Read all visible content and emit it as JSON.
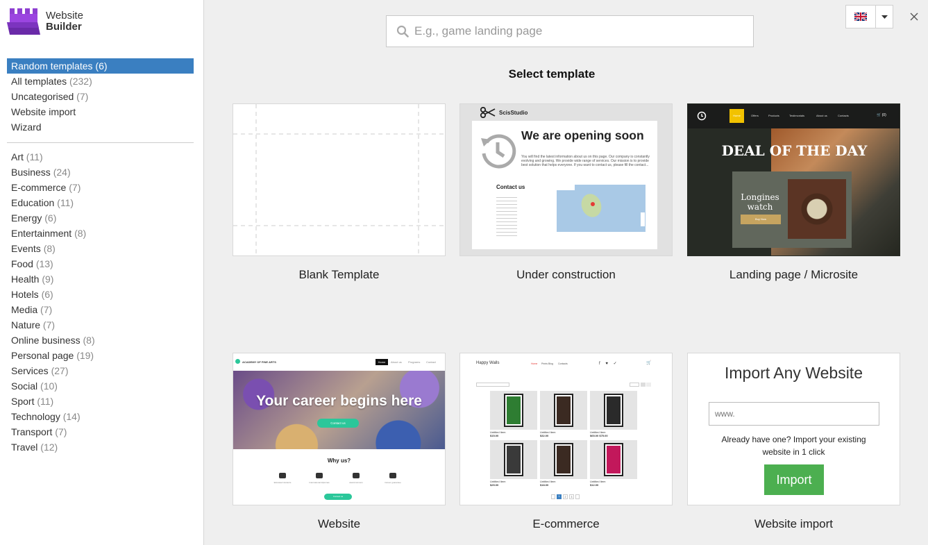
{
  "brand": {
    "line1": "Website",
    "line2": "Builder"
  },
  "nav_primary": [
    {
      "name": "Random templates",
      "count": "(6)",
      "active": true
    },
    {
      "name": "All templates",
      "count": "(232)"
    },
    {
      "name": "Uncategorised",
      "count": "(7)"
    },
    {
      "name": "Website import",
      "count": ""
    },
    {
      "name": "Wizard",
      "count": ""
    }
  ],
  "nav_categories": [
    {
      "name": "Art",
      "count": "(11)"
    },
    {
      "name": "Business",
      "count": "(24)"
    },
    {
      "name": "E-commerce",
      "count": "(7)"
    },
    {
      "name": "Education",
      "count": "(11)"
    },
    {
      "name": "Energy",
      "count": "(6)"
    },
    {
      "name": "Entertainment",
      "count": "(8)"
    },
    {
      "name": "Events",
      "count": "(8)"
    },
    {
      "name": "Food",
      "count": "(13)"
    },
    {
      "name": "Health",
      "count": "(9)"
    },
    {
      "name": "Hotels",
      "count": "(6)"
    },
    {
      "name": "Media",
      "count": "(7)"
    },
    {
      "name": "Nature",
      "count": "(7)"
    },
    {
      "name": "Online business",
      "count": "(8)"
    },
    {
      "name": "Personal page",
      "count": "(19)"
    },
    {
      "name": "Services",
      "count": "(27)"
    },
    {
      "name": "Social",
      "count": "(10)"
    },
    {
      "name": "Sport",
      "count": "(11)"
    },
    {
      "name": "Technology",
      "count": "(14)"
    },
    {
      "name": "Transport",
      "count": "(7)"
    },
    {
      "name": "Travel",
      "count": "(12)"
    }
  ],
  "search": {
    "placeholder": "E.g., game landing page",
    "value": ""
  },
  "language": {
    "flag": "uk-flag-icon"
  },
  "heading": "Select template",
  "templates": {
    "blank": {
      "label": "Blank Template"
    },
    "construction": {
      "label": "Under construction",
      "brand": "ScisStudio",
      "headline": "We are opening soon",
      "body": "You will find the latest information about us on this page. Our company is constantly evolving and growing. We provide wide range of services. Our mission is to provide best solution that helps everyone. If you want to contact us, please fill the contact...",
      "contact": "Contact us"
    },
    "landing": {
      "label": "Landing page / Microsite",
      "nav": [
        "Home",
        "Offers",
        "Products",
        "Testimonials",
        "About us",
        "Contacts"
      ],
      "cart": "(0)",
      "headline": "DEAL OF THE DAY",
      "product": "Longines watch",
      "buy": "Buy Now"
    },
    "website": {
      "label": "Website",
      "brand": "ACADEMY OF FINE ARTS",
      "nav": [
        "Home",
        "About us",
        "Programs",
        "Contact"
      ],
      "hero": "Your career begins here",
      "cta": "Contact us",
      "why": "Why us?",
      "features": [
        "Educated students",
        "International diplomas",
        "Award winners",
        "Career guarantee"
      ]
    },
    "ecommerce": {
      "label": "E-commerce",
      "brand": "Happy Walls",
      "nav": [
        "Home",
        "Prints Blog",
        "Contacts"
      ],
      "products": [
        {
          "name": "Untitled Item",
          "price": "$15.00"
        },
        {
          "name": "Untitled Item",
          "price": "$32.00"
        },
        {
          "name": "Untitled Item",
          "price": "$65.00 $75.00"
        },
        {
          "name": "Untitled Item",
          "price": "$25.00"
        },
        {
          "name": "Untitled Item",
          "price": "$18.00"
        },
        {
          "name": "Untitled Item",
          "price": "$12.00"
        }
      ],
      "pages": [
        "1",
        "2",
        "3"
      ]
    },
    "import": {
      "label": "Website import",
      "title": "Import Any Website",
      "placeholder": "www.",
      "note": "Already have one? Import your existing website in 1 click",
      "button": "Import"
    }
  },
  "colors": {
    "active": "#3a7fc1",
    "import_button": "#4caf50",
    "ecom_accent": "#e53935",
    "landing_accent": "#f2c200",
    "website_cta": "#2bc79a"
  }
}
